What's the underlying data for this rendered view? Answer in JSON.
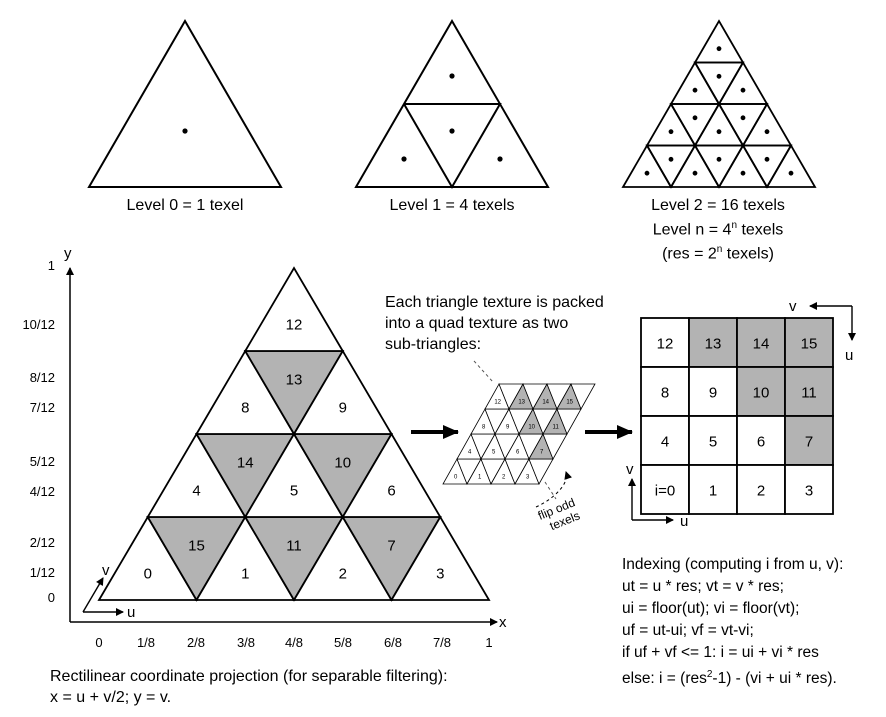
{
  "levels": {
    "level0": "Level 0 = 1 texel",
    "level1": "Level 1 = 4 texels",
    "level2": "Level 2 = 16 texels",
    "leveln_prefix": "Level n = 4",
    "leveln_sup": "n",
    "leveln_suffix": " texels",
    "res_prefix": "(res = 2",
    "res_sup": "n",
    "res_suffix": " texels)"
  },
  "main_triangle": {
    "axis_x": "x",
    "axis_y": "y",
    "axis_u": "u",
    "axis_v": "v",
    "y_ticks": [
      "1",
      "10/12",
      "8/12",
      "7/12",
      "5/12",
      "4/12",
      "2/12",
      "1/12",
      "0"
    ],
    "x_ticks": [
      "0",
      "1/8",
      "2/8",
      "3/8",
      "4/8",
      "5/8",
      "6/8",
      "7/8",
      "1"
    ],
    "cells": [
      "0",
      "15",
      "1",
      "11",
      "2",
      "7",
      "3",
      "4",
      "14",
      "5",
      "10",
      "6",
      "8",
      "13",
      "9",
      "12"
    ]
  },
  "packing": {
    "text": [
      "Each triangle texture is packed",
      "into a quad texture as two",
      "sub-triangles:"
    ],
    "flip_note": [
      "flip odd",
      "texels"
    ],
    "mini_labels": [
      "0",
      "15",
      "1",
      "11",
      "2",
      "7",
      "3",
      "4",
      "14",
      "5",
      "10",
      "6",
      "8",
      "13",
      "9",
      "12"
    ]
  },
  "quad": {
    "axis_u": "u",
    "axis_v": "v",
    "rows": [
      [
        "12",
        "13",
        "14",
        "15"
      ],
      [
        "8",
        "9",
        "10",
        "11"
      ],
      [
        "4",
        "5",
        "6",
        "7"
      ],
      [
        "i=0",
        "1",
        "2",
        "3"
      ]
    ],
    "shaded": [
      [
        false,
        true,
        true,
        true
      ],
      [
        false,
        false,
        true,
        true
      ],
      [
        false,
        false,
        false,
        true
      ],
      [
        false,
        false,
        false,
        false
      ]
    ]
  },
  "indexing": {
    "lines": [
      "Indexing (computing i from u, v):",
      "ut = u * res;  vt = v * res;",
      "ui = floor(ut);  vi = floor(vt);",
      "uf = ut-ui;  vf = vt-vi;",
      "if uf + vf <= 1:  i = ui + vi * res"
    ],
    "else_prefix": "else:   i = (res",
    "else_sup": "2",
    "else_suffix": "-1) - (vi + ui * res)."
  },
  "projection": {
    "line1": "Rectilinear coordinate projection (for separable filtering):",
    "line2": "x  = u + v/2;  y = v."
  },
  "colors": {
    "shade": "#b3b3b3",
    "stroke": "#000000",
    "dashed": "#555555"
  }
}
